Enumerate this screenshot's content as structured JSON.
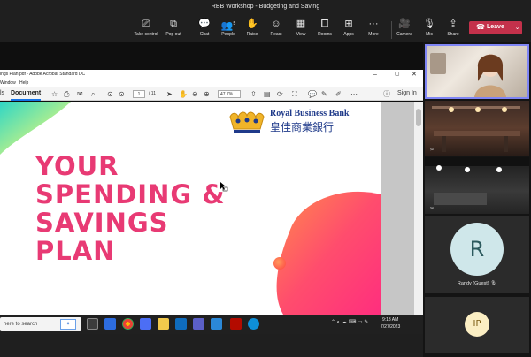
{
  "window": {
    "title": "RBB Workshop - Budgeting and Saving"
  },
  "toolbar": {
    "items": [
      {
        "label": "Take control",
        "icon": "take-control-icon",
        "glyph": "⎚"
      },
      {
        "label": "Pop out",
        "icon": "pop-out-icon",
        "glyph": "⧉"
      },
      {
        "label": "Chat",
        "icon": "chat-icon",
        "glyph": "💬"
      },
      {
        "label": "People",
        "icon": "people-icon",
        "glyph": "👥",
        "count": "5"
      },
      {
        "label": "Raise",
        "icon": "raise-hand-icon",
        "glyph": "✋"
      },
      {
        "label": "React",
        "icon": "react-icon",
        "glyph": "☺"
      },
      {
        "label": "View",
        "icon": "view-icon",
        "glyph": "▦"
      },
      {
        "label": "Rooms",
        "icon": "rooms-icon",
        "glyph": "⧠"
      },
      {
        "label": "Apps",
        "icon": "apps-icon",
        "glyph": "⊞"
      },
      {
        "label": "More",
        "icon": "more-icon",
        "glyph": "···"
      },
      {
        "label": "Camera",
        "icon": "camera-icon",
        "glyph": "🎥"
      },
      {
        "label": "Mic",
        "icon": "mic-muted-icon",
        "glyph": "🎙"
      },
      {
        "label": "Share",
        "icon": "share-icon",
        "glyph": "⇪"
      }
    ],
    "leave_label": "Leave"
  },
  "acrobat": {
    "title": "ings Plan.pdf - Adobe Acrobat Standard DC",
    "menu": [
      "Window",
      "Help"
    ],
    "tab_partial": "ls",
    "doc_tab": "Document",
    "page_current": "1",
    "page_total": "/ 11",
    "zoom": "47.7%",
    "sign_in": "Sign In"
  },
  "slide": {
    "title_lines": [
      "YOUR",
      "SPENDING &",
      "SAVINGS",
      "PLAN"
    ],
    "bank_name": "Royal Business Bank",
    "bank_name_zh": "皇佳商業銀行",
    "colors": {
      "title": "#e83a74",
      "bank": "#1f3a8a",
      "crown": "#f0b429"
    }
  },
  "taskbar": {
    "search_placeholder": "here to search",
    "time": "9:13 AM",
    "date": "7/27/2023"
  },
  "participants": [
    {
      "type": "video"
    },
    {
      "type": "video"
    },
    {
      "type": "video"
    },
    {
      "type": "avatar",
      "initials": "R",
      "name": "Randy (Guest)"
    },
    {
      "type": "avatar",
      "initials": "IP"
    }
  ]
}
